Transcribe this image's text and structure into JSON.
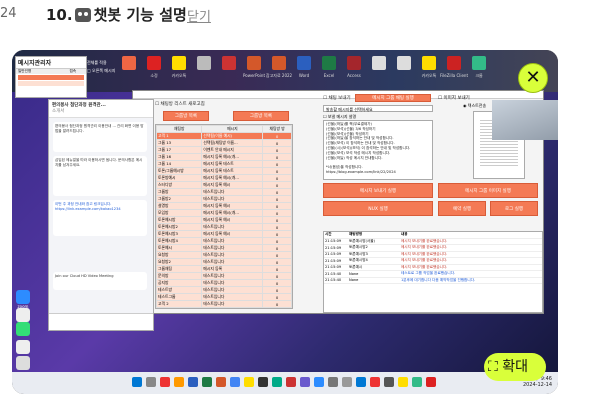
{
  "header": {
    "step_number": "24",
    "title_prefix": "10.",
    "title_text": "챗봇 기능 설명",
    "close_link": "닫기"
  },
  "desktop": {
    "top_icons": [
      "",
      "소정",
      "카카오톡",
      "",
      "",
      "PowerPoint",
      "참고자료 2022",
      "Word",
      "Excel",
      "Access",
      "",
      "",
      "카카오톡",
      "FileZilla Client",
      "크롬"
    ],
    "side_icons": [
      "zoom",
      "",
      "",
      "",
      ""
    ]
  },
  "messenger_panel": {
    "title": "메시지관리자",
    "col1": "일반인명",
    "col2": "접속",
    "checkbox_label": "전체를 적용",
    "sub_label": "□ 오른쪽 메시지"
  },
  "chat_window": {
    "title": "편의봉사 첨단과정 원격관...",
    "subtitle": "소개서",
    "bubbles": [
      "편의봉사 첨단과정 원격관리 이용안내 ... 관리 화면 이용 방법을 알려드립니다.",
      "삽입된 메뉴얼을 따라 이용하시면 됩니다. 문의사항은 메시지를 남겨주세요.",
      "이번 주 과정 안내와 참고 링크입니다. https://link.example.com/kakao1234",
      "Join our Cloud HD Video Meeting"
    ]
  },
  "app": {
    "top_checkbox": "채팅방 리스트 새로고침",
    "btn_get_rooms": "그룹방 목록",
    "btn_get_friends": "그룹방 목록",
    "table_headers": [
      "채팅방",
      "메시지",
      "채팅방 방"
    ],
    "rows": [
      {
        "c1": "고객 1",
        "c2": "선택됨(이름 예시)",
        "c3": "0",
        "style": "sel"
      },
      {
        "c1": "그룹 13",
        "c2": "선택됨(채팅방 이름...",
        "c3": "0",
        "style": "pk"
      },
      {
        "c1": "그룹 17",
        "c2": "이벤트 안내 메시지",
        "c3": "0",
        "style": "pk"
      },
      {
        "c1": "그룹 16",
        "c2": "메시지 등록 예시(개...",
        "c3": "0",
        "style": "pk"
      },
      {
        "c1": "그룹 14",
        "c2": "메시지 등록 테스트",
        "c3": "0",
        "style": "pk"
      },
      {
        "c1": "토론/그룹예시방",
        "c2": "메시지 등록 테스트",
        "c3": "0",
        "style": "pk"
      },
      {
        "c1": "토론방예시",
        "c2": "메시지 등록 예시(개...",
        "c3": "0",
        "style": "pk"
      },
      {
        "c1": "스터디방",
        "c2": "메시지 등록 예시",
        "c3": "0",
        "style": "pk"
      },
      {
        "c1": "그룹방",
        "c2": "테스트입니다",
        "c3": "0",
        "style": "pk"
      },
      {
        "c1": "그룹방2",
        "c2": "테스트입니다",
        "c3": "0",
        "style": "pk"
      },
      {
        "c1": "설명방",
        "c2": "메시지 등록 예시",
        "c3": "0",
        "style": "pk"
      },
      {
        "c1": "모임방",
        "c2": "메시지 등록 예시(개...",
        "c3": "0",
        "style": "pk"
      },
      {
        "c1": "토론예시방",
        "c2": "메시지 등록 예시",
        "c3": "0",
        "style": "pk"
      },
      {
        "c1": "토론예시방2",
        "c2": "테스트입니다",
        "c3": "0",
        "style": "pk"
      },
      {
        "c1": "토론예시방3",
        "c2": "메시지 등록 예시",
        "c3": "0",
        "style": "pk"
      },
      {
        "c1": "토론예시방4",
        "c2": "테스트입니다",
        "c3": "0",
        "style": "pk"
      },
      {
        "c1": "토론예시",
        "c2": "테스트입니다",
        "c3": "0",
        "style": "pk"
      },
      {
        "c1": "요청방",
        "c2": "테스트입니다",
        "c3": "0",
        "style": "pk"
      },
      {
        "c1": "요청방2",
        "c2": "테스트입니다",
        "c3": "0",
        "style": "pk"
      },
      {
        "c1": "그룹채팅",
        "c2": "메시지 등록",
        "c3": "0",
        "style": "pk"
      },
      {
        "c1": "문의방",
        "c2": "테스트입니다",
        "c3": "0",
        "style": "pk"
      },
      {
        "c1": "공지방",
        "c2": "테스트입니다",
        "c3": "0",
        "style": "pk"
      },
      {
        "c1": "테스트방",
        "c2": "테스트입니다",
        "c3": "0",
        "style": "pk"
      },
      {
        "c1": "테스트그룹",
        "c2": "테스트입니다",
        "c3": "0",
        "style": "pk"
      },
      {
        "c1": "고객 2",
        "c2": "테스트입니다",
        "c3": "0",
        "style": "pk"
      }
    ],
    "msg_checkbox": "채팅 보내기",
    "btn_send_group": "메시지 그룹 채팅 실행",
    "dropdown": "발송할 메시지를 선택하세요",
    "msg_label": "보낼 메시지 설명",
    "msg_lines": [
      "(선물)(하늘)를 책(무료결제가)",
      "(선물)(보석)(선물) 3/6 작성하기",
      "(선물)(보석)(선물) 작성하기",
      "(선물)(하늘)을 참석하는 안내 및 작성합니다.",
      "(선물)(보석) 이 참석하는 안내 및 작성합니다.",
      "(선물)(시)(보석)(보석) 이 참석하는 안내 및 작성합니다.",
      "(선물)(보석) 보석 작성 메시지 작성합니다.",
      "(선물)(하늘) 작성 메시지 안내합니다.",
      "",
      "*너(음성)을 작성합니다.",
      "https://blog.example.com/link/22/2024"
    ],
    "btn_msg_send": "메시지 보내기 실행",
    "btn_stop": "NUX 실행",
    "btn_log": "로그 실행",
    "radio1": "텍스트전송",
    "radio2": "이미지전송",
    "img_checkbox": "이미지 보내기",
    "btn_img_send": "메시지 그룹 이미지 실행",
    "btn_img_log": "예약 실행",
    "btn_img_log2": "로그 실행",
    "log_headers": [
      "시간",
      "채팅방명",
      "내용"
    ],
    "log_rows": [
      {
        "t": "21:15:09",
        "r": "토론예시방(서울)",
        "m": "메시지 보내기를 완료했습니다.",
        "cls": "rd"
      },
      {
        "t": "21:15:09",
        "r": "토론예시방2",
        "m": "메시지 보내기를 완료했습니다.",
        "cls": "rd"
      },
      {
        "t": "21:15:09",
        "r": "토론예시방3",
        "m": "메시지 보내기를 완료했습니다.",
        "cls": "rd"
      },
      {
        "t": "21:15:09",
        "r": "토론예시방4",
        "m": "메시지 보내기를 완료했습니다.",
        "cls": "rd"
      },
      {
        "t": "21:15:09",
        "r": "토론예시",
        "m": "메시지 보내기를 완료했습니다.",
        "cls": "rd"
      },
      {
        "t": "21:15:40",
        "r": "None",
        "m": "테스트로 그룹 작업을 완료했습니다.",
        "cls": "bl"
      },
      {
        "t": "21:15:40",
        "r": "None",
        "m": "1분후에 대기합니다 다음 예약작업을 진행합니다.",
        "cls": "bl"
      }
    ]
  },
  "overlay": {
    "close_icon": "✕",
    "zoom_icon": "⛶",
    "zoom_label": "확대"
  },
  "taskbar": {
    "time": "오후 9:46",
    "date": "2024-12-14"
  },
  "colors": {
    "accent_orange": "#f47a55",
    "overlay_lime": "#d9ff3a"
  }
}
